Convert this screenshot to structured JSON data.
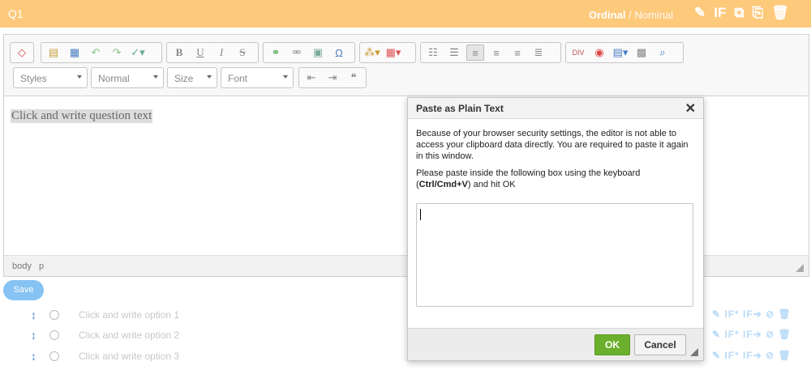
{
  "question": {
    "number": "Q1",
    "type_active": "Ordinal",
    "type_separator": " / ",
    "type_inactive": "Nominal",
    "actions": [
      "edit-icon",
      "IF",
      "copy-icon",
      "export-icon",
      "trash-icon"
    ],
    "if_label": "IF"
  },
  "editor": {
    "combos": {
      "styles": "Styles",
      "format": "Normal",
      "size": "Size",
      "font": "Font"
    },
    "content_placeholder": "Click and write question text",
    "status_path": [
      "body",
      "p"
    ]
  },
  "save_label": "Save",
  "options": [
    {
      "label": "Click and write option 1",
      "actions": "IF* IF"
    },
    {
      "label": "Click and write option 2",
      "actions": "IF* IF"
    },
    {
      "label": "Click and write option 3",
      "actions": "IF* IF"
    }
  ],
  "dialog": {
    "title": "Paste as Plain Text",
    "message": "Because of your browser security settings, the editor is not able to access your clipboard data directly. You are required to paste it again in this window.",
    "instruction_pre": "Please paste inside the following box using the keyboard (",
    "instruction_keys": "Ctrl/Cmd+V",
    "instruction_post": ") and hit OK",
    "ok_label": "OK",
    "cancel_label": "Cancel"
  },
  "colors": {
    "header_bg": "#fdc97a",
    "save_bg": "#86c3f3",
    "ok_bg": "#6bb02c",
    "option_icon": "#4a90d9"
  }
}
